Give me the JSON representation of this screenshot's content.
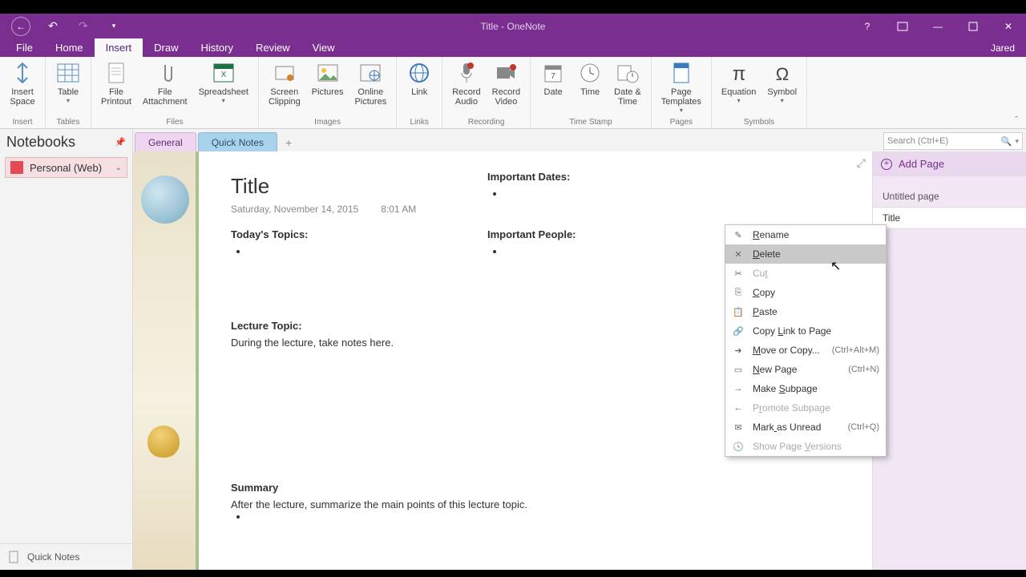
{
  "titlebar": {
    "title": "Title - OneNote",
    "user": "Jared"
  },
  "menu_tabs": {
    "file": "File",
    "items": [
      "Home",
      "Insert",
      "Draw",
      "History",
      "Review",
      "View"
    ],
    "active": "Insert"
  },
  "ribbon": {
    "groups": [
      {
        "label": "Insert",
        "items": [
          {
            "label": "Insert\nSpace",
            "icon": "insert-space"
          }
        ]
      },
      {
        "label": "Tables",
        "items": [
          {
            "label": "Table",
            "icon": "table",
            "dropdown": true
          }
        ]
      },
      {
        "label": "Files",
        "items": [
          {
            "label": "File\nPrintout",
            "icon": "file-printout"
          },
          {
            "label": "File\nAttachment",
            "icon": "attachment"
          },
          {
            "label": "Spreadsheet",
            "icon": "spreadsheet",
            "dropdown": true
          }
        ]
      },
      {
        "label": "Images",
        "items": [
          {
            "label": "Screen\nClipping",
            "icon": "screen-clip"
          },
          {
            "label": "Pictures",
            "icon": "pictures"
          },
          {
            "label": "Online\nPictures",
            "icon": "online-pictures"
          }
        ]
      },
      {
        "label": "Links",
        "items": [
          {
            "label": "Link",
            "icon": "link"
          }
        ]
      },
      {
        "label": "Recording",
        "items": [
          {
            "label": "Record\nAudio",
            "icon": "audio"
          },
          {
            "label": "Record\nVideo",
            "icon": "video"
          }
        ]
      },
      {
        "label": "Time Stamp",
        "items": [
          {
            "label": "Date",
            "icon": "date"
          },
          {
            "label": "Time",
            "icon": "time"
          },
          {
            "label": "Date &\nTime",
            "icon": "datetime"
          }
        ]
      },
      {
        "label": "Pages",
        "items": [
          {
            "label": "Page\nTemplates",
            "icon": "template",
            "dropdown": true
          }
        ]
      },
      {
        "label": "Symbols",
        "items": [
          {
            "label": "Equation",
            "icon": "equation",
            "dropdown": true
          },
          {
            "label": "Symbol",
            "icon": "symbol",
            "dropdown": true
          }
        ]
      }
    ]
  },
  "notebooks": {
    "header": "Notebooks",
    "current": "Personal (Web)",
    "bottom": "Quick Notes"
  },
  "sections": {
    "items": [
      "General",
      "Quick Notes"
    ],
    "active": "Quick Notes"
  },
  "search": {
    "placeholder": "Search (Ctrl+E)"
  },
  "page": {
    "title": "Title",
    "date": "Saturday, November 14, 2015",
    "time": "8:01 AM",
    "topics_header": "Today's Topics:",
    "dates_header": "Important Dates:",
    "people_header": "Important People:",
    "lecture_header": "Lecture Topic:",
    "lecture_body": "During the lecture, take notes here.",
    "summary_header": "Summary",
    "summary_body": "After the lecture, summarize the main points of this lecture topic."
  },
  "page_list": {
    "add": "Add Page",
    "items": [
      "Untitled page",
      "Title"
    ],
    "selected": "Title"
  },
  "context_menu": {
    "items": [
      {
        "label": "Rename",
        "u": 0,
        "icon": "rename"
      },
      {
        "label": "Delete",
        "u": 0,
        "icon": "delete",
        "hover": true
      },
      {
        "label": "Cut",
        "u": 2,
        "icon": "cut",
        "disabled": true
      },
      {
        "label": "Copy",
        "u": 0,
        "icon": "copy"
      },
      {
        "label": "Paste",
        "u": 0,
        "icon": "paste"
      },
      {
        "label": "Copy Link to Page",
        "u": 5,
        "icon": "link-page"
      },
      {
        "label": "Move or Copy...",
        "u": 0,
        "icon": "move",
        "shortcut": "(Ctrl+Alt+M)"
      },
      {
        "label": "New Page",
        "u": 0,
        "icon": "new-page",
        "shortcut": "(Ctrl+N)"
      },
      {
        "label": "Make Subpage",
        "u": 5,
        "icon": "subpage"
      },
      {
        "label": "Promote Subpage",
        "u": 1,
        "icon": "promote",
        "disabled": true
      },
      {
        "label": "Mark as Unread",
        "u": 4,
        "icon": "unread",
        "shortcut": "(Ctrl+Q)"
      },
      {
        "label": "Show Page Versions",
        "u": 10,
        "icon": "versions",
        "disabled": true
      }
    ]
  }
}
